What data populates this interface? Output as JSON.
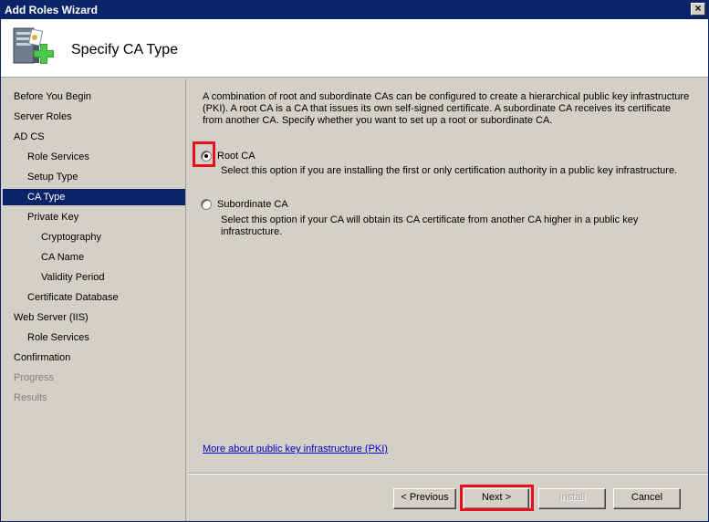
{
  "window": {
    "title": "Add Roles Wizard",
    "close_label": "×"
  },
  "header": {
    "title": "Specify CA Type",
    "icon": "server-add-role-icon"
  },
  "sidebar": {
    "items": [
      {
        "label": "Before You Begin",
        "state": "normal"
      },
      {
        "label": "Server Roles",
        "state": "normal"
      },
      {
        "label": "AD CS",
        "state": "normal"
      },
      {
        "label": "Role Services",
        "state": "normal"
      },
      {
        "label": "Setup Type",
        "state": "normal"
      },
      {
        "label": "CA Type",
        "state": "selected"
      },
      {
        "label": "Private Key",
        "state": "normal"
      },
      {
        "label": "Cryptography",
        "state": "normal"
      },
      {
        "label": "CA Name",
        "state": "normal"
      },
      {
        "label": "Validity Period",
        "state": "normal"
      },
      {
        "label": "Certificate Database",
        "state": "normal"
      },
      {
        "label": "Web Server (IIS)",
        "state": "normal"
      },
      {
        "label": "Role Services",
        "state": "normal"
      },
      {
        "label": "Confirmation",
        "state": "normal"
      },
      {
        "label": "Progress",
        "state": "disabled"
      },
      {
        "label": "Results",
        "state": "disabled"
      }
    ]
  },
  "main": {
    "description": "A combination of root and subordinate CAs can be configured to create a hierarchical public key infrastructure (PKI). A root CA is a CA that issues its own self-signed certificate. A subordinate CA receives its certificate from another CA. Specify whether you want to set up a root or subordinate CA.",
    "options": [
      {
        "label": "Root CA",
        "description": "Select this option if you are installing the first or only certification authority in a public key infrastructure.",
        "selected": true
      },
      {
        "label": "Subordinate CA",
        "description": "Select this option if your CA will obtain its CA certificate from another CA higher in a public key infrastructure.",
        "selected": false
      }
    ],
    "link": "More about public key infrastructure (PKI)"
  },
  "buttons": {
    "previous": "< Previous",
    "next": "Next >",
    "install": "Install",
    "cancel": "Cancel"
  },
  "colors": {
    "title_bar": "#0a246a",
    "selection": "#0a246a",
    "highlight": "#e8101e",
    "link": "#0000cc"
  }
}
